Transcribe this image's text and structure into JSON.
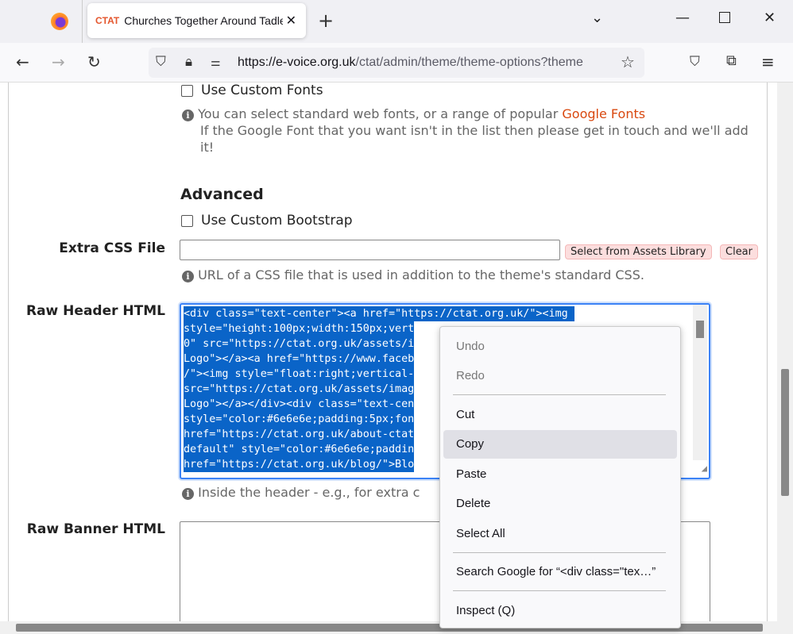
{
  "browser": {
    "tab_title": "Churches Together Around Tadley",
    "tab_favicon": "CTAT",
    "url_domain": "https://e-voice.org.uk",
    "url_path": "/ctat/admin/theme/theme-options?theme"
  },
  "form": {
    "custom_fonts_label": "Use Custom Fonts",
    "fonts_help_prefix": "You can select standard web fonts, or a range of popular ",
    "fonts_help_link": "Google Fonts",
    "fonts_help_2": "If the Google Font that you want isn't in the list then please get in touch and we'll add it!",
    "advanced_heading": "Advanced",
    "custom_bootstrap_label": "Use Custom Bootstrap",
    "extra_css_label": "Extra CSS File",
    "extra_css_value": "",
    "select_assets_button": "Select from Assets Library",
    "clear_button": "Clear",
    "extra_css_help": "URL of a CSS file that is used in addition to the theme's standard CSS.",
    "raw_header_label": "Raw Header HTML",
    "raw_header_lines": [
      "<div class=\"text-center\"><a href=\"https://ctat.org.uk/\"><img ",
      "style=\"height:100px;width:150px;vert",
      "0\" src=\"https://ctat.org.uk/assets/i",
      "Logo\"></a><a href=\"https://www.faceb",
      "/\"><img style=\"float:right;vertical-",
      "src=\"https://ctat.org.uk/assets/imag",
      "Logo\"></a></div><div class=\"text-cen",
      "style=\"color:#6e6e6e;padding:5px;fon",
      "href=\"https://ctat.org.uk/about-ctat",
      "default\" style=\"color:#6e6e6e;paddin",
      "href=\"https://ctat.org.uk/blog/\">Blo"
    ],
    "raw_header_help": "Inside the header - e.g., for extra c",
    "raw_banner_label": "Raw Banner HTML",
    "raw_banner_value": ""
  },
  "context_menu": {
    "items": [
      {
        "label": "Undo",
        "enabled": false
      },
      {
        "label": "Redo",
        "enabled": false
      },
      {
        "label": "Cut",
        "enabled": true
      },
      {
        "label": "Copy",
        "enabled": true,
        "highlighted": true
      },
      {
        "label": "Paste",
        "enabled": true
      },
      {
        "label": "Delete",
        "enabled": true
      },
      {
        "label": "Select All",
        "enabled": true
      },
      {
        "label": "Search Google for “<div class=\"tex…”",
        "enabled": true
      },
      {
        "label": "Inspect (Q)",
        "enabled": true
      }
    ]
  }
}
